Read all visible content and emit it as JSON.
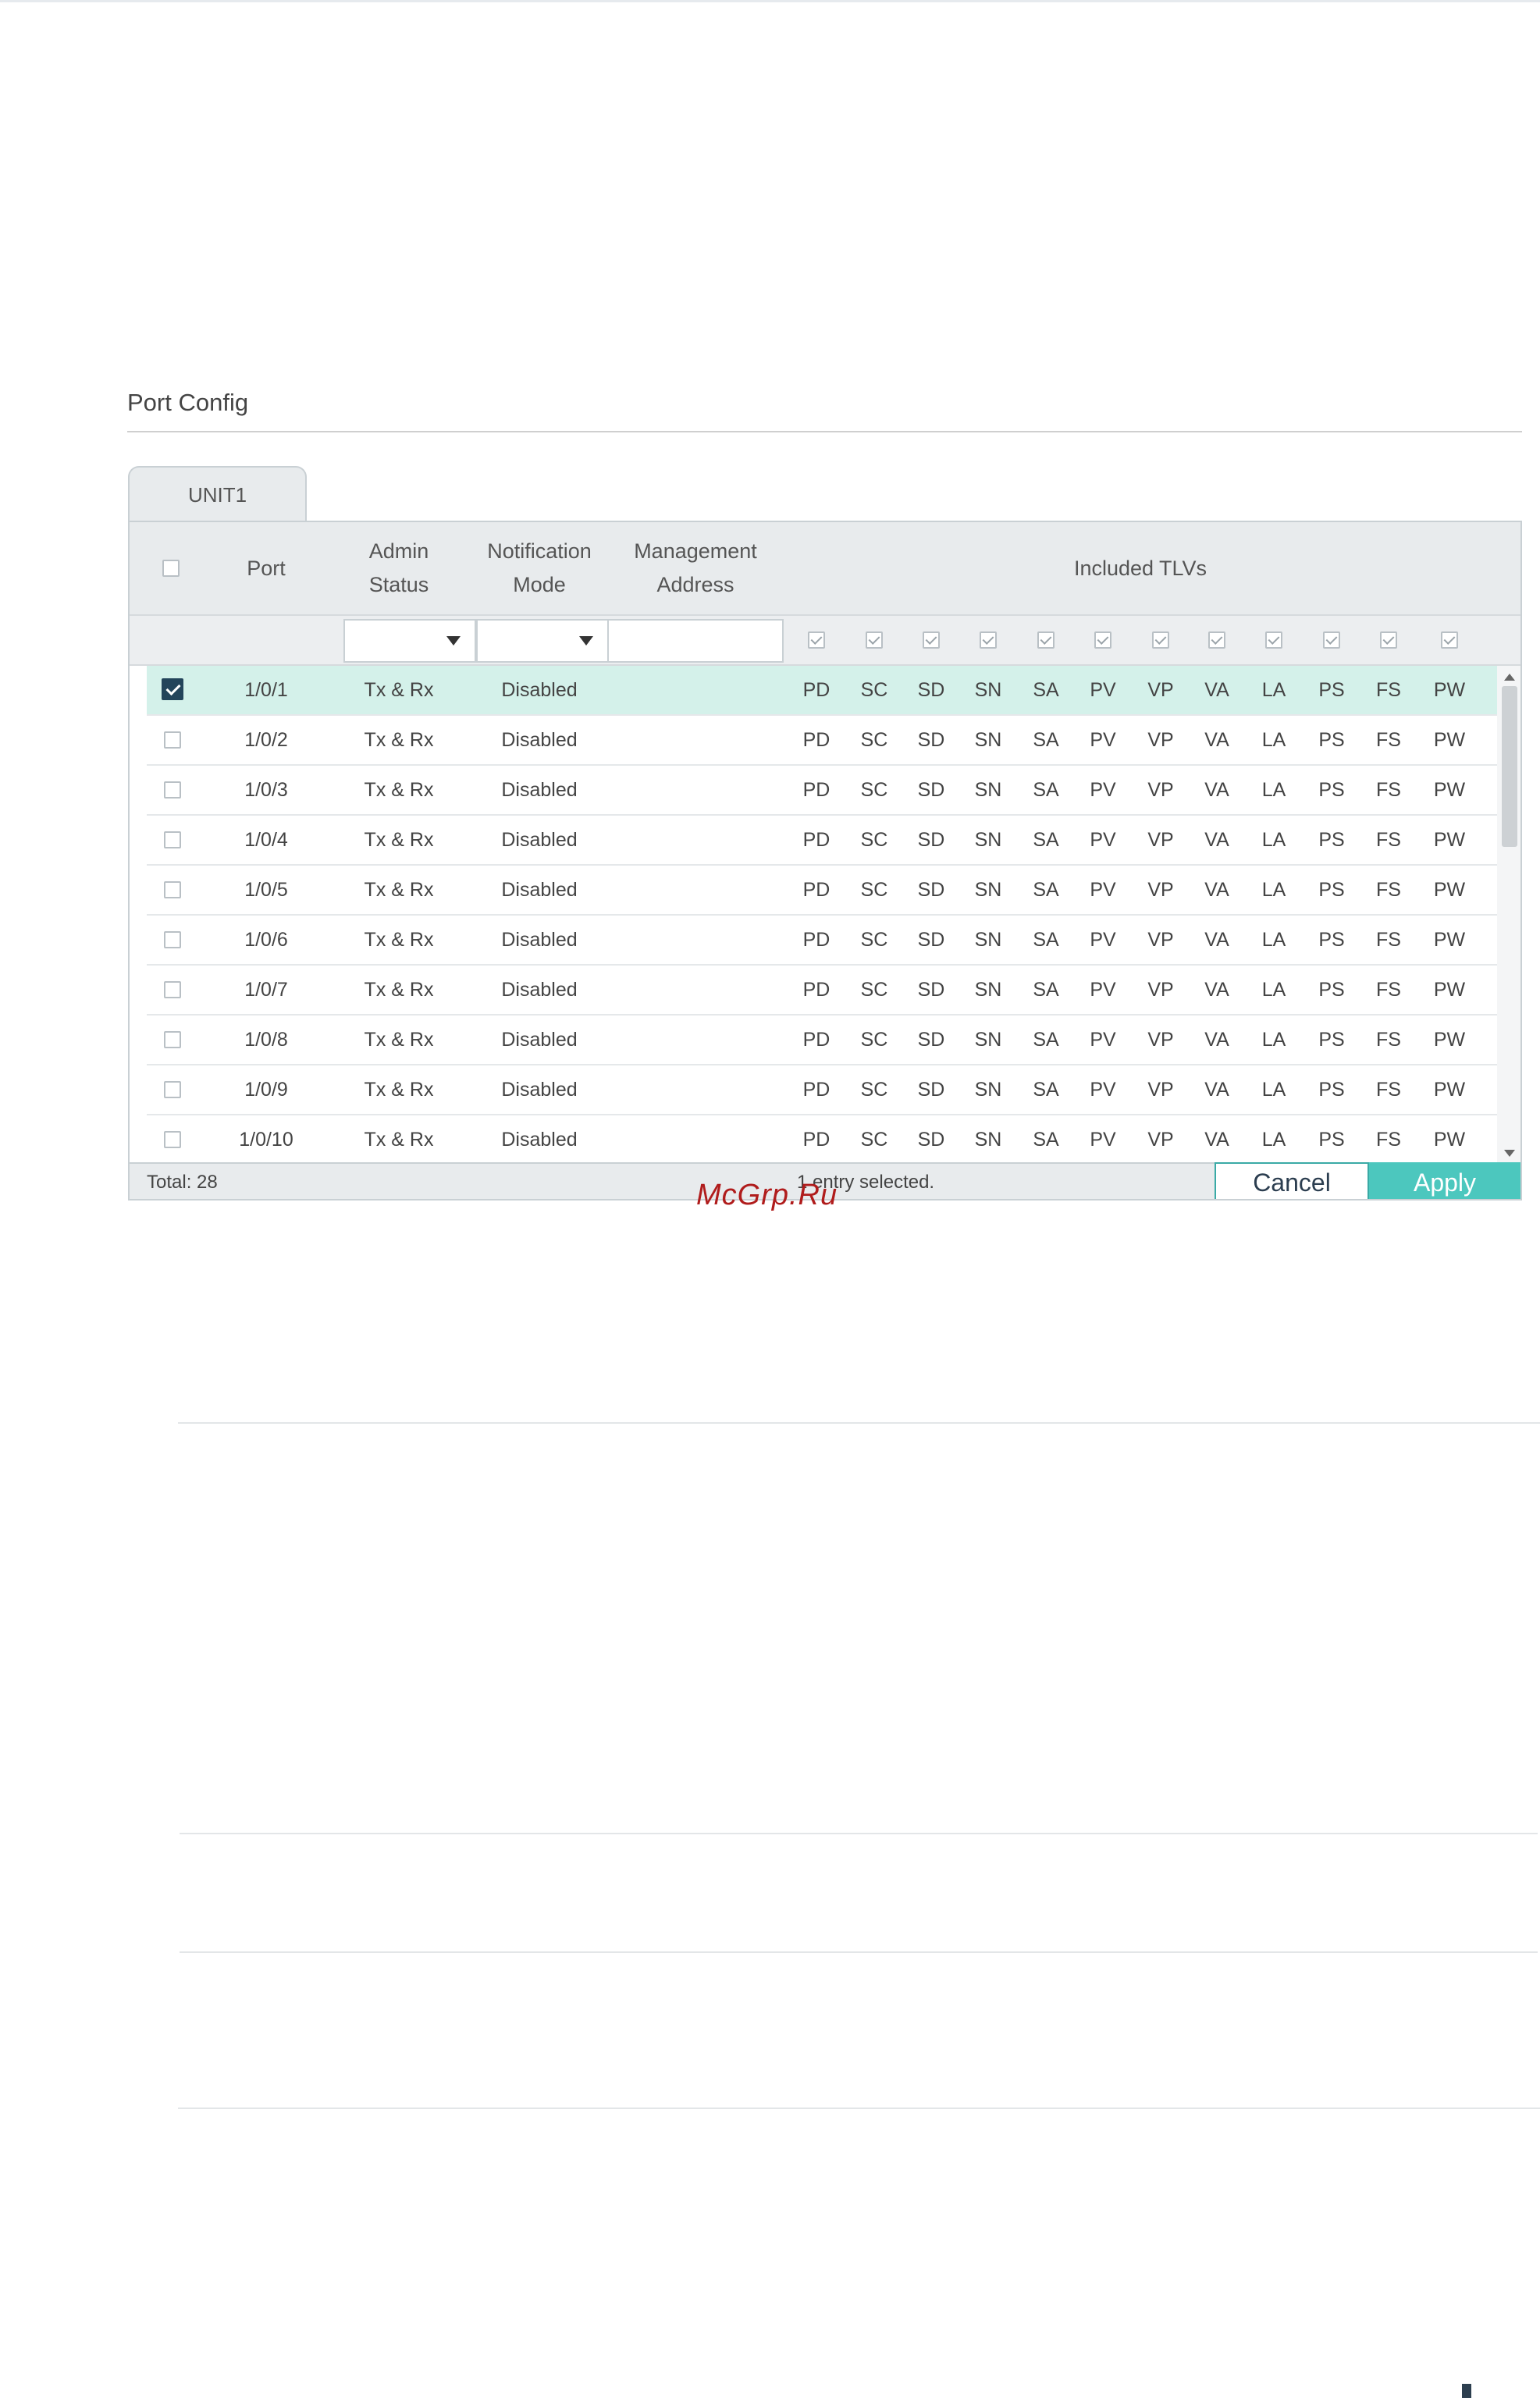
{
  "section_title": "Port Config",
  "tab_label": "UNIT1",
  "columns": {
    "port": "Port",
    "admin_status": [
      "Admin",
      "Status"
    ],
    "notification_mode": [
      "Notification",
      "Mode"
    ],
    "management_address": [
      "Management",
      "Address"
    ],
    "included_tlvs": "Included TLVs"
  },
  "tlvs": [
    "PD",
    "SC",
    "SD",
    "SN",
    "SA",
    "PV",
    "VP",
    "VA",
    "LA",
    "PS",
    "FS",
    "PW"
  ],
  "rows": [
    {
      "port": "1/0/1",
      "admin_status": "Tx & Rx",
      "notification_mode": "Disabled",
      "management_address": "",
      "checked": true
    },
    {
      "port": "1/0/2",
      "admin_status": "Tx & Rx",
      "notification_mode": "Disabled",
      "management_address": "",
      "checked": false
    },
    {
      "port": "1/0/3",
      "admin_status": "Tx & Rx",
      "notification_mode": "Disabled",
      "management_address": "",
      "checked": false
    },
    {
      "port": "1/0/4",
      "admin_status": "Tx & Rx",
      "notification_mode": "Disabled",
      "management_address": "",
      "checked": false
    },
    {
      "port": "1/0/5",
      "admin_status": "Tx & Rx",
      "notification_mode": "Disabled",
      "management_address": "",
      "checked": false
    },
    {
      "port": "1/0/6",
      "admin_status": "Tx & Rx",
      "notification_mode": "Disabled",
      "management_address": "",
      "checked": false
    },
    {
      "port": "1/0/7",
      "admin_status": "Tx & Rx",
      "notification_mode": "Disabled",
      "management_address": "",
      "checked": false
    },
    {
      "port": "1/0/8",
      "admin_status": "Tx & Rx",
      "notification_mode": "Disabled",
      "management_address": "",
      "checked": false
    },
    {
      "port": "1/0/9",
      "admin_status": "Tx & Rx",
      "notification_mode": "Disabled",
      "management_address": "",
      "checked": false
    },
    {
      "port": "1/0/10",
      "admin_status": "Tx & Rx",
      "notification_mode": "Disabled",
      "management_address": "",
      "checked": false
    }
  ],
  "footer": {
    "total": "Total: 28",
    "selected": "1 entry selected.",
    "cancel_label": "Cancel",
    "apply_label": "Apply"
  },
  "watermark": "McGrp.Ru",
  "colors": {
    "selected_row": "#d4f1ea",
    "apply_button": "#4cc7be",
    "checked_box": "#23445a",
    "watermark": "#b01c1c"
  }
}
